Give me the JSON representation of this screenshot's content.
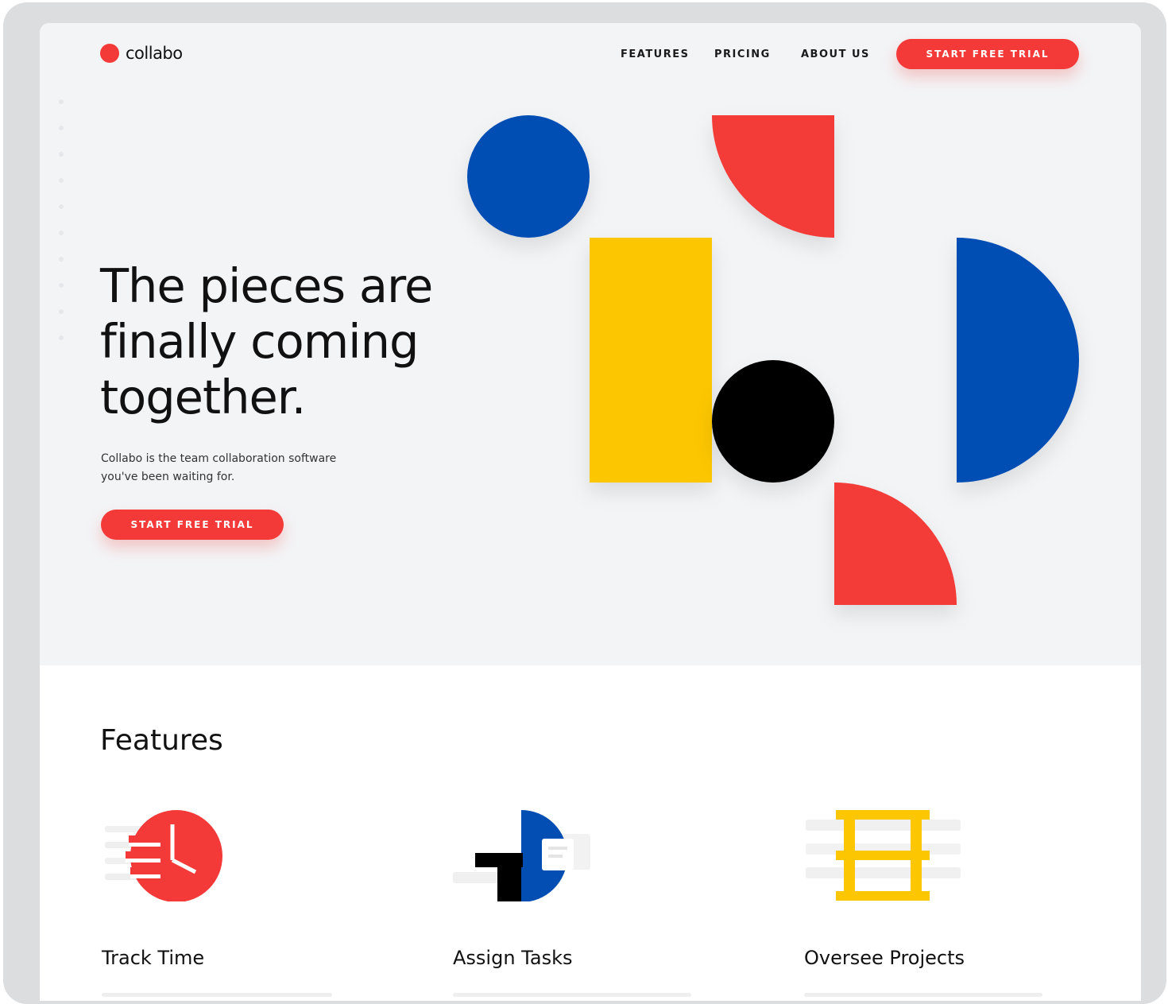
{
  "brand": {
    "name": "collabo",
    "accent": "#f33a38"
  },
  "nav": {
    "items": [
      {
        "label": "FEATURES"
      },
      {
        "label": "PRICING"
      },
      {
        "label": "ABOUT US"
      }
    ],
    "cta_label": "START FREE TRIAL"
  },
  "hero": {
    "headline": "The pieces are finally coming together.",
    "subtext": "Collabo is the team collaboration software you've been waiting for.",
    "cta_label": "START FREE TRIAL"
  },
  "palette": {
    "red": "#f33a38",
    "blue": "#034eb3",
    "yellow": "#fcc601",
    "black": "#000000"
  },
  "features": {
    "title": "Features",
    "items": [
      {
        "label": "Track Time",
        "icon": "clock-icon"
      },
      {
        "label": "Assign Tasks",
        "icon": "assign-tasks-icon"
      },
      {
        "label": "Oversee Projects",
        "icon": "project-grid-icon"
      }
    ]
  }
}
